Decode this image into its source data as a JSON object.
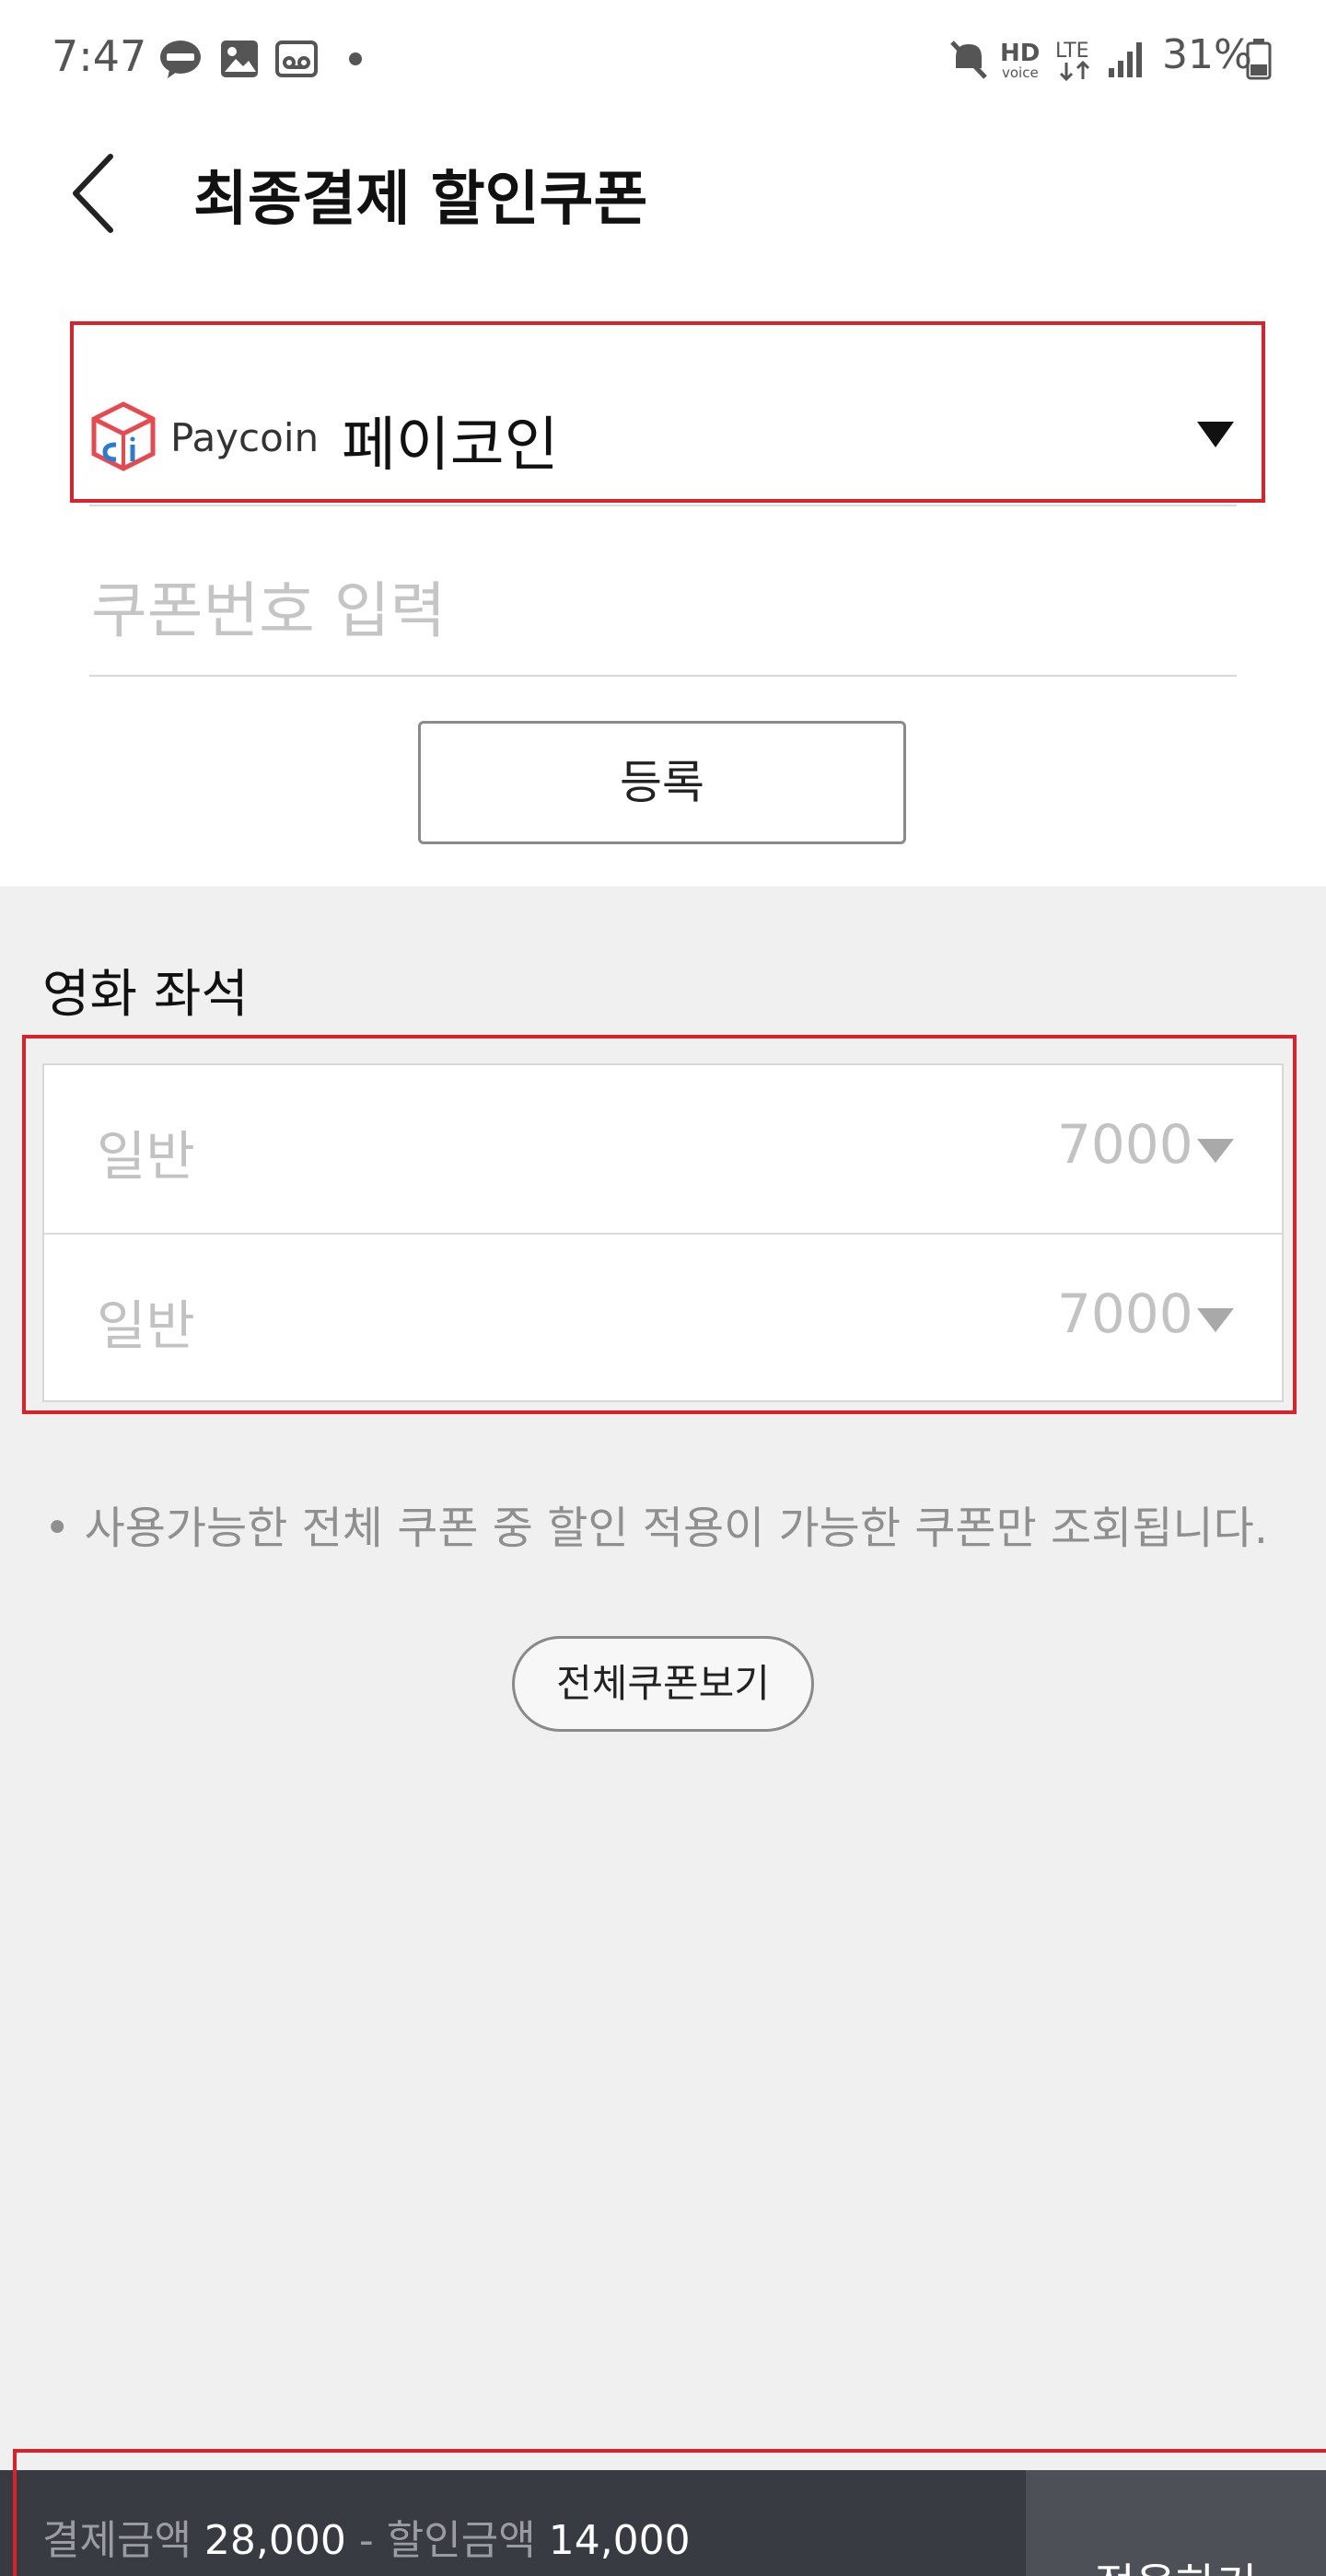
{
  "status_bar": {
    "time": "7:47",
    "right_text": "31%",
    "icons": [
      "kakaotalk-icon",
      "gallery-icon",
      "voicemail-icon",
      "dot-icon",
      "mute-icon",
      "hd-voice-icon",
      "lte-icon",
      "signal-icon",
      "battery-icon"
    ]
  },
  "header": {
    "title": "최종결제 할인쿠폰"
  },
  "payment_method": {
    "logo_text": "Paycoin",
    "name": "페이코인"
  },
  "coupon": {
    "placeholder": "쿠폰번호 입력",
    "register_label": "등록"
  },
  "seats": {
    "section_title": "영화 좌석",
    "rows": [
      {
        "label": "일반",
        "value": "7000"
      },
      {
        "label": "일반",
        "value": "7000"
      }
    ]
  },
  "note": "• 사용가능한 전체 쿠폰 중 할인 적용이 가능한 쿠폰만 조회됩니다.",
  "view_all_label": "전체쿠폰보기",
  "summary": {
    "pay_label": "결제금액",
    "pay_amount": "28,000",
    "separator": "-",
    "discount_label": "할인금액",
    "discount_amount": "14,000",
    "apply_label": "적용하기"
  },
  "colors": {
    "highlight_red": "#d8232a",
    "bottom_bar": "#383b42",
    "apply_button": "#4e5058"
  }
}
